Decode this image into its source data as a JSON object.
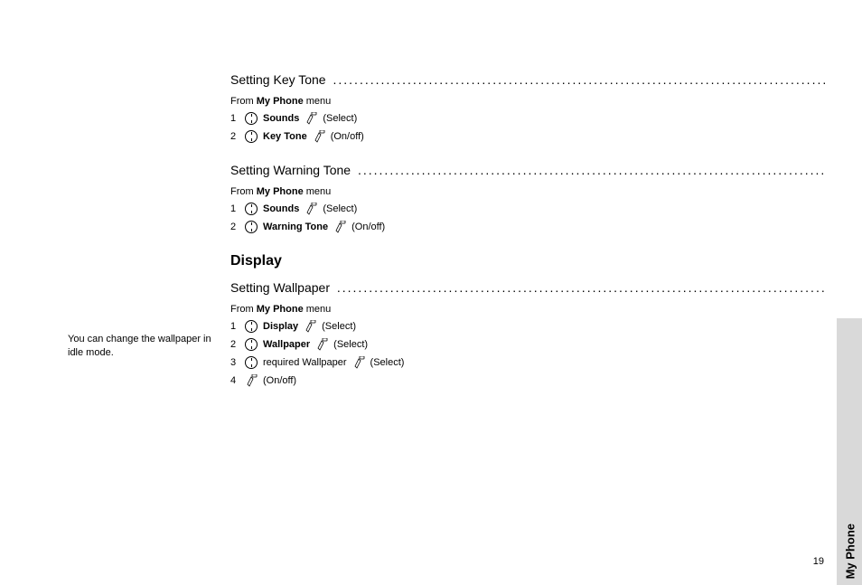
{
  "sideTab": "My Phone",
  "pageNumber": "19",
  "sections": {
    "keyTone": {
      "title": "Setting Key Tone",
      "intro_prefix": "From ",
      "intro_bold": "My Phone",
      "intro_suffix": " menu",
      "step1_num": "1",
      "step1_label": "Sounds",
      "step1_action": "(Select)",
      "step2_num": "2",
      "step2_label": "Key Tone",
      "step2_action": "(On/off)"
    },
    "warningTone": {
      "title": "Setting Warning Tone",
      "intro_prefix": "From ",
      "intro_bold": "My Phone",
      "intro_suffix": " menu",
      "step1_num": "1",
      "step1_label": "Sounds",
      "step1_action": "(Select)",
      "step2_num": "2",
      "step2_label": "Warning Tone",
      "step2_action": "(On/off)"
    },
    "display": {
      "heading": "Display",
      "sidenote": "You can change the wallpaper in idle mode.",
      "wallpaper": {
        "title": "Setting Wallpaper",
        "intro_prefix": "From ",
        "intro_bold": "My Phone",
        "intro_suffix": " menu",
        "step1_num": "1",
        "step1_label": "Display",
        "step1_action": "(Select)",
        "step2_num": "2",
        "step2_label": "Wallpaper",
        "step2_action": "(Select)",
        "step3_num": "3",
        "step3_label": "required Wallpaper",
        "step3_action": "(Select)",
        "step4_num": "4",
        "step4_action": "(On/off)"
      }
    }
  }
}
